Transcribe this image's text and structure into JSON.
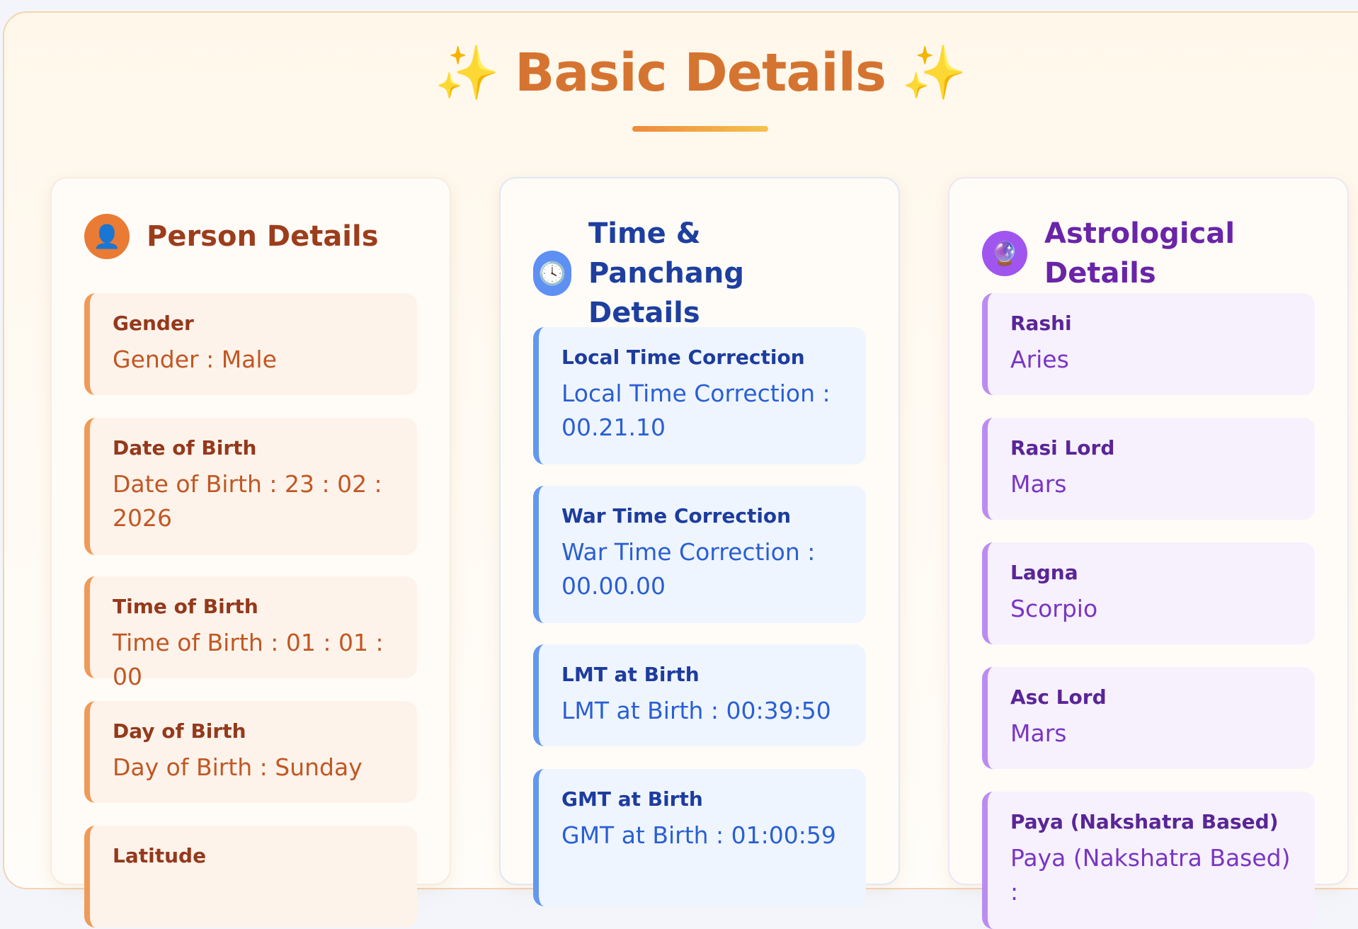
{
  "header": {
    "sparkle_left": "✨",
    "title": "Basic Details",
    "sparkle_right": "✨"
  },
  "person": {
    "title": "Person Details",
    "icon": "person-icon",
    "fields": [
      {
        "label": "Gender",
        "value": "Gender : Male"
      },
      {
        "label": "Date of Birth",
        "value": "Date of Birth : 23 : 02 : 2026"
      },
      {
        "label": "Time of Birth",
        "value": "Time of Birth : 01 : 01 : 00"
      },
      {
        "label": "Day of Birth",
        "value": "Day of Birth : Sunday"
      },
      {
        "label": "Latitude",
        "value": ""
      }
    ]
  },
  "time": {
    "title": "Time & Panchang Details",
    "icon": "clock-icon",
    "fields": [
      {
        "label": "Local Time Correction",
        "value": "Local Time Correction : 00.21.10"
      },
      {
        "label": "War Time Correction",
        "value": "War Time Correction : 00.00.00"
      },
      {
        "label": "LMT at Birth",
        "value": "LMT at Birth : 00:39:50"
      },
      {
        "label": "GMT at Birth",
        "value": "GMT at Birth : 01:00:59"
      }
    ]
  },
  "astro": {
    "title": "Astrological Details",
    "icon": "crystal-ball-icon",
    "fields": [
      {
        "label": "Rashi",
        "value": "Aries"
      },
      {
        "label": "Rasi Lord",
        "value": "Mars"
      },
      {
        "label": "Lagna",
        "value": "Scorpio"
      },
      {
        "label": "Asc Lord",
        "value": "Mars"
      },
      {
        "label": "Paya (Nakshatra Based)",
        "value": "Paya (Nakshatra Based) :"
      }
    ]
  }
}
